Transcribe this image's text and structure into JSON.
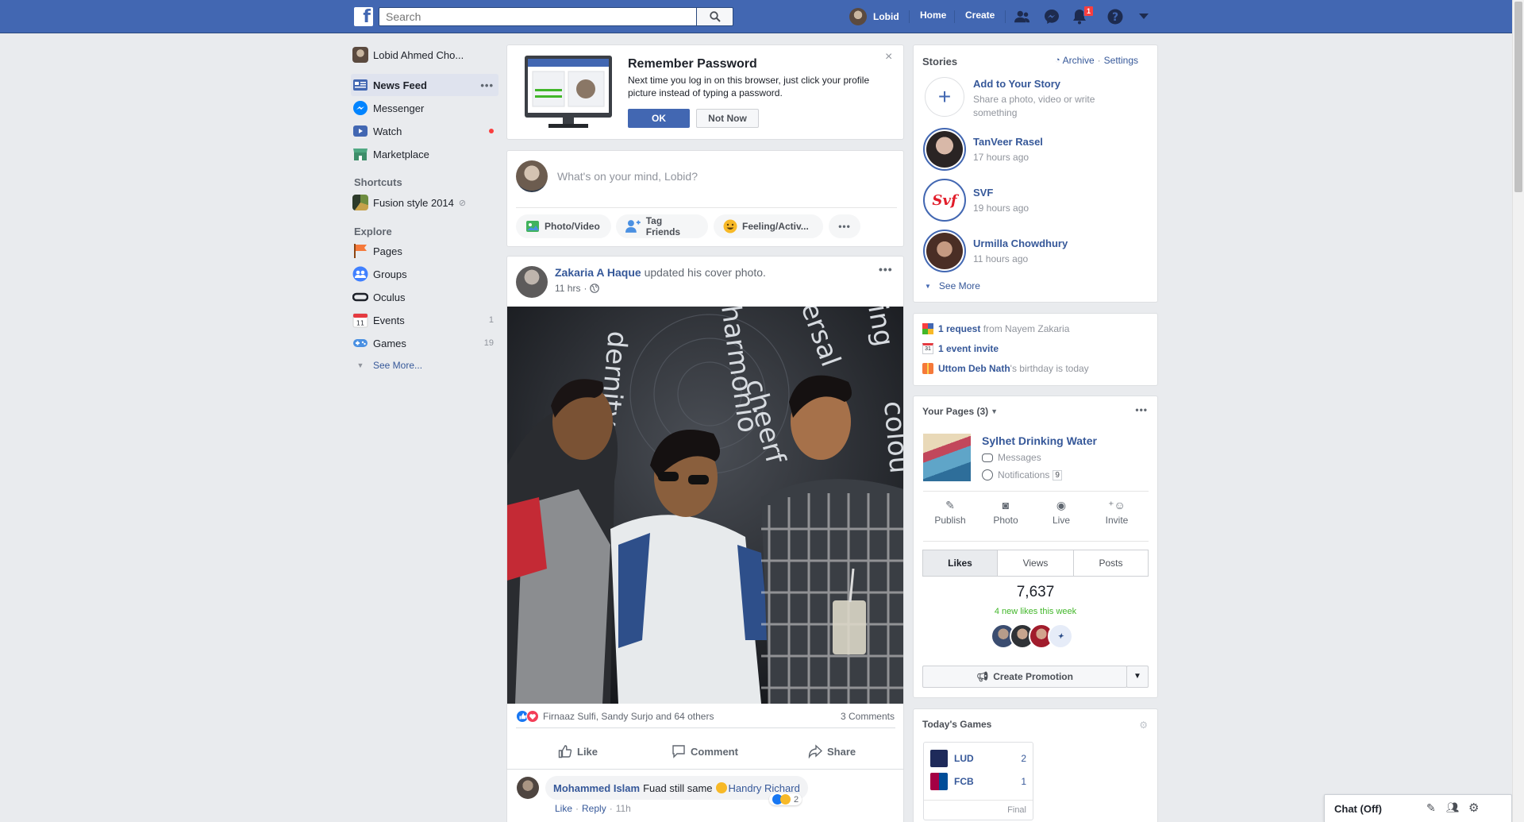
{
  "topbar": {
    "logo": "f",
    "search_placeholder": "Search",
    "profile_name": "Lobid",
    "home": "Home",
    "create": "Create",
    "notification_count": "1"
  },
  "leftnav": {
    "profile": "Lobid Ahmed Cho...",
    "items": [
      {
        "label": "News Feed",
        "count": ""
      },
      {
        "label": "Messenger",
        "count": ""
      },
      {
        "label": "Watch",
        "count": ""
      },
      {
        "label": "Marketplace",
        "count": ""
      }
    ],
    "shortcuts_title": "Shortcuts",
    "shortcut": "Fusion style 2014",
    "explore_title": "Explore",
    "explore": [
      {
        "label": "Pages",
        "count": ""
      },
      {
        "label": "Groups",
        "count": ""
      },
      {
        "label": "Oculus",
        "count": ""
      },
      {
        "label": "Events",
        "count": "1"
      },
      {
        "label": "Games",
        "count": "19"
      }
    ],
    "see_more": "See More..."
  },
  "remember": {
    "title": "Remember Password",
    "text": "Next time you log in on this browser, just click your profile picture instead of typing a password.",
    "ok": "OK",
    "not_now": "Not Now"
  },
  "composer": {
    "placeholder": "What's on your mind, Lobid?",
    "photo": "Photo/Video",
    "tag": "Tag Friends",
    "feeling": "Feeling/Activ..."
  },
  "post": {
    "author": "Zakaria A Haque",
    "action": "updated his cover photo.",
    "time": "11 hrs",
    "reactions": "Firnaaz Sulfi, Sandy Surjo and 64 others",
    "comments": "3 Comments",
    "like": "Like",
    "comment": "Comment",
    "share": "Share",
    "photo_words": "dernity, harmonio, ersal, cheerf, ing, colou",
    "comment1": {
      "author": "Mohammed Islam",
      "text": "Fuad still same",
      "tag": "Handry Richard",
      "react_count": "2",
      "like": "Like",
      "reply": "Reply",
      "time": "11h"
    }
  },
  "stories": {
    "title": "Stories",
    "archive": "Archive",
    "settings": "Settings",
    "add_title": "Add to Your Story",
    "add_sub": "Share a photo, video or write something",
    "items": [
      {
        "name": "TanVeer Rasel",
        "time": "17 hours ago"
      },
      {
        "name": "SVF",
        "time": "19 hours ago"
      },
      {
        "name": "Urmilla Chowdhury",
        "time": "11 hours ago"
      }
    ],
    "svf_logo": "Svf",
    "see_more": "See More"
  },
  "requests": {
    "req_bold": "1 request",
    "req_rest": " from Nayem Zakaria",
    "event": "1 event invite",
    "bday_name": "Uttom Deb Nath",
    "bday_rest": "'s birthday is today"
  },
  "pages": {
    "title": "Your Pages (3)",
    "name": "Sylhet Drinking Water",
    "messages": "Messages",
    "notifications": "Notifications",
    "notif_count": "9",
    "actions": [
      "Publish",
      "Photo",
      "Live",
      "Invite"
    ],
    "tabs": [
      "Likes",
      "Views",
      "Posts"
    ],
    "likes": "7,637",
    "new_likes": "4 new likes this week",
    "promo": "Create Promotion"
  },
  "games": {
    "title": "Today's Games",
    "teams": [
      {
        "name": "LUD",
        "score": "2"
      },
      {
        "name": "FCB",
        "score": "1"
      }
    ],
    "status": "Final"
  },
  "chat": {
    "label": "Chat (Off)"
  }
}
